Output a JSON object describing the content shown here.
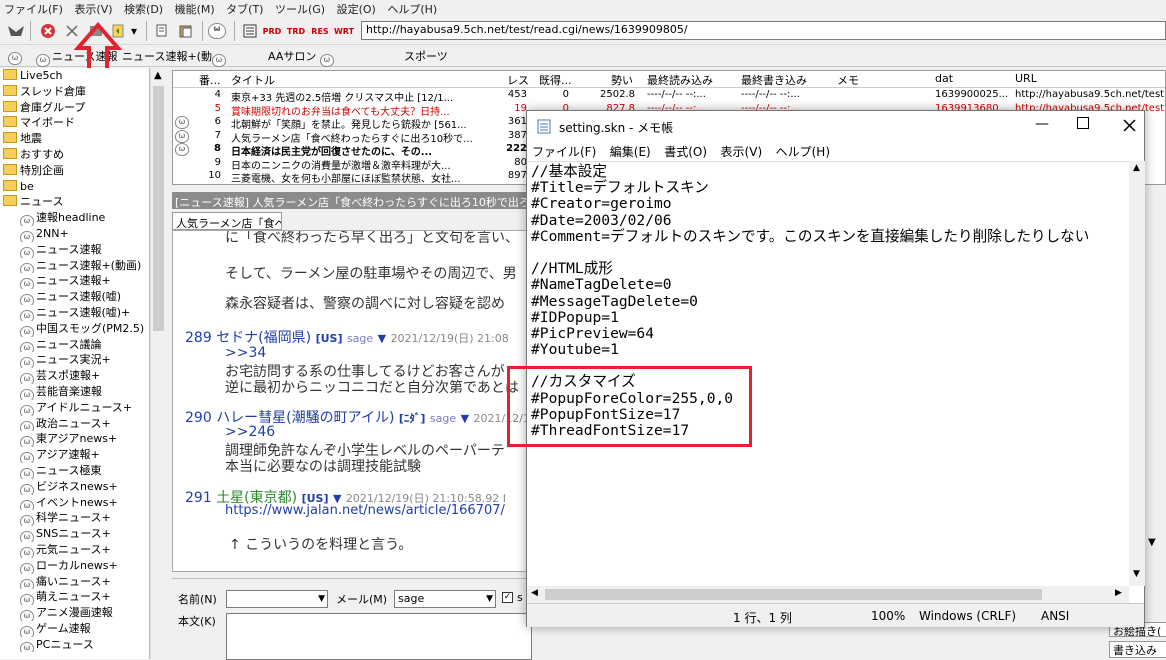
{
  "menubar": [
    "ファイル(F)",
    "表示(V)",
    "検索(D)",
    "機能(M)",
    "タブ(T)",
    "ツール(G)",
    "設定(O)",
    "ヘルプ(H)"
  ],
  "toolbar": {
    "url": "http://hayabusa9.5ch.net/test/read.cgi/news/1639909805/",
    "tb_prd": "PRD",
    "tb_trd": "TRD",
    "tb_res": "RES",
    "tb_wrt": "WRT"
  },
  "board_tabs": [
    "ニュース速報",
    "ニュース速報+(動",
    "AAサロン",
    "スポーツ"
  ],
  "tree": {
    "items": [
      {
        "label": "Live5ch",
        "type": "folder"
      },
      {
        "label": "スレッド倉庫",
        "type": "folder"
      },
      {
        "label": "倉庫グループ",
        "type": "folder"
      },
      {
        "label": "マイボード",
        "type": "folder"
      },
      {
        "label": "地震",
        "type": "folder"
      },
      {
        "label": "おすすめ",
        "type": "folder"
      },
      {
        "label": "特別企画",
        "type": "folder"
      },
      {
        "label": "be",
        "type": "folder"
      },
      {
        "label": "ニュース",
        "type": "folder"
      },
      {
        "label": "速報headline",
        "type": "board"
      },
      {
        "label": "2NN+",
        "type": "board"
      },
      {
        "label": "ニュース速報",
        "type": "board"
      },
      {
        "label": "ニュース速報+(動画)",
        "type": "board"
      },
      {
        "label": "ニュース速報+",
        "type": "board"
      },
      {
        "label": "ニュース速報(嘘)",
        "type": "board"
      },
      {
        "label": "ニュース速報(嘘)+",
        "type": "board"
      },
      {
        "label": "中国スモッグ(PM2.5)",
        "type": "board"
      },
      {
        "label": "ニュース議論",
        "type": "board"
      },
      {
        "label": "ニュース実況+",
        "type": "board"
      },
      {
        "label": "芸スポ速報+",
        "type": "board"
      },
      {
        "label": "芸能音楽速報",
        "type": "board"
      },
      {
        "label": "アイドルニュース+",
        "type": "board"
      },
      {
        "label": "政治ニュース+",
        "type": "board"
      },
      {
        "label": "東アジアnews+",
        "type": "board"
      },
      {
        "label": "アジア速報+",
        "type": "board"
      },
      {
        "label": "ニュース極東",
        "type": "board"
      },
      {
        "label": "ビジネスnews+",
        "type": "board"
      },
      {
        "label": "イベントnews+",
        "type": "board"
      },
      {
        "label": "科学ニュース+",
        "type": "board"
      },
      {
        "label": "SNSニュース+",
        "type": "board"
      },
      {
        "label": "元気ニュース+",
        "type": "board"
      },
      {
        "label": "ローカルnews+",
        "type": "board"
      },
      {
        "label": "痛いニュース+",
        "type": "board"
      },
      {
        "label": "萌えニュース+",
        "type": "board"
      },
      {
        "label": "アニメ漫画速報",
        "type": "board"
      },
      {
        "label": "ゲーム速報",
        "type": "board"
      },
      {
        "label": "PCニュース",
        "type": "board"
      }
    ]
  },
  "threadlist": {
    "headers": [
      "番...",
      "タイトル",
      "レス",
      "既得...",
      "勢い",
      "最終読み込み",
      "最終書き込み",
      "メモ",
      "dat",
      "URL"
    ],
    "rows": [
      {
        "icon": "",
        "num": "4",
        "title": "東京+33 先週の2.5倍増 クリスマス中止 [12/1...",
        "res": "453",
        "got": "0",
        "power": "2502.8",
        "lastread": "----/--/-- --:...",
        "lastwrite": "----/--/-- --:...",
        "dat": "1639900025...",
        "url": "http://hayabusa9.5ch.net/test",
        "color": "#000",
        "bold": false
      },
      {
        "icon": "",
        "num": "5",
        "title": "賞味期限切れのお弁当は食べても大丈夫？日持...",
        "res": "19",
        "got": "0",
        "power": "827.8",
        "lastread": "----/--/-- --:...",
        "lastwrite": "----/--/-- --:...",
        "dat": "1639913680...",
        "url": "http://hayabusa9.5ch.net/test",
        "color": "#d00000",
        "bold": false
      },
      {
        "icon": "cat",
        "num": "6",
        "title": "北朝鮮が「笑顔」を禁止。発見したら銃殺か [561...",
        "res": "361",
        "got": "",
        "power": "",
        "lastread": "",
        "lastwrite": "",
        "dat": "",
        "url": "",
        "color": "#000",
        "bold": false
      },
      {
        "icon": "cat",
        "num": "7",
        "title": "人気ラーメン店「食べ終わったらすぐに出ろ10秒で...",
        "res": "387",
        "got": "",
        "power": "",
        "lastread": "",
        "lastwrite": "",
        "dat": "",
        "url": "",
        "color": "#000",
        "bold": false
      },
      {
        "icon": "cat",
        "num": "8",
        "title": "日本経済は民主党が回復させたのに、その...",
        "res": "222",
        "got": "",
        "power": "",
        "lastread": "",
        "lastwrite": "",
        "dat": "",
        "url": "",
        "color": "#000",
        "bold": true
      },
      {
        "icon": "",
        "num": "9",
        "title": "日本のニンニクの消費量が激増＆激辛料理が大...",
        "res": "80",
        "got": "",
        "power": "",
        "lastread": "",
        "lastwrite": "",
        "dat": "",
        "url": "",
        "color": "#000",
        "bold": false
      },
      {
        "icon": "",
        "num": "10",
        "title": "三菱電機、女を何も小部屋にほぼ監禁状態、女社...",
        "res": "897",
        "got": "",
        "power": "",
        "lastread": "",
        "lastwrite": "",
        "dat": "",
        "url": "",
        "color": "#000",
        "bold": false
      }
    ]
  },
  "threadbar": "[ニュース速報] 人気ラーメン店「食べ終わったらすぐに出ろ10秒で出ろ",
  "threadtab": "人気ラーメン店「食べ",
  "posts": {
    "pre1": "に「食べ終わったら早く出ろ」と文句を言い、",
    "pre2": "そして、ラーメン屋の駐車場やその周辺で、男",
    "pre3": "森永容疑者は、警察の調べに対し容疑を認め",
    "p289_num": "289",
    "p289_name": "セドナ(福岡県)",
    "p289_tag": "[US]",
    "p289_mail": "sage",
    "p289_arrow": "▼",
    "p289_date": "2021/12/19(日) 21:08",
    "p289_anchor": ">>34",
    "p289_l1": "お宅訪問する系の仕事してるけどお客さんが",
    "p289_l2": "逆に最初からニッコニコだと自分次第であとは",
    "p290_num": "290",
    "p290_name": "ハレー彗星(潮騒の町アイル)",
    "p290_tag": "[ﾆﾀﾞ]",
    "p290_mail": "sage",
    "p290_arrow": "▼",
    "p290_date": "2021/12/19(",
    "p290_anchor": ">>246",
    "p290_l1": "調理師免許なんぞ小学生レベルのペーパーテ",
    "p290_l2": "本当に必要なのは調理技能試験",
    "p291_num": "291",
    "p291_name": "土星(東京都)",
    "p291_tag": "[US]",
    "p291_arrow": "▼",
    "p291_date": "2021/12/19(日) 21:10:58.92 I",
    "p291_link": "https://www.jalan.net/news/article/166707/",
    "p291_l1": "↑ こういうのを料理と言う。"
  },
  "form": {
    "name_label": "名前(N)",
    "mail_label": "メール(M)",
    "mail_value": "sage",
    "sage_label": "s",
    "body_label": "本文(K)"
  },
  "notepad": {
    "title": "setting.skn - メモ帳",
    "menu": [
      "ファイル(F)",
      "編集(E)",
      "書式(O)",
      "表示(V)",
      "ヘルプ(H)"
    ],
    "lines": [
      "//基本設定",
      "#Title=デフォルトスキン",
      "#Creator=geroimo",
      "#Date=2003/02/06",
      "#Comment=デフォルトのスキンです。このスキンを直接編集したり削除したりしない",
      "",
      "//HTML成形",
      "#NameTagDelete=0",
      "#MessageTagDelete=0",
      "#IDPopup=1",
      "#PicPreview=64",
      "#Youtube=1",
      "",
      "//カスタマイズ",
      "#PopupForeColor=255,0,0",
      "#PopupFontSize=17",
      "#ThreadFontSize=17"
    ],
    "status_pos": "1 行、1 列",
    "status_zoom": "100%",
    "status_eol": "Windows (CRLF)",
    "status_enc": "ANSI"
  },
  "rightstrip": {
    "item1": "お絵描き(",
    "item2": "書き込み"
  },
  "colors": {
    "highlight": "#e4222f",
    "post_blue": "#1f3fa8",
    "post_green": "#2c8a2c"
  }
}
